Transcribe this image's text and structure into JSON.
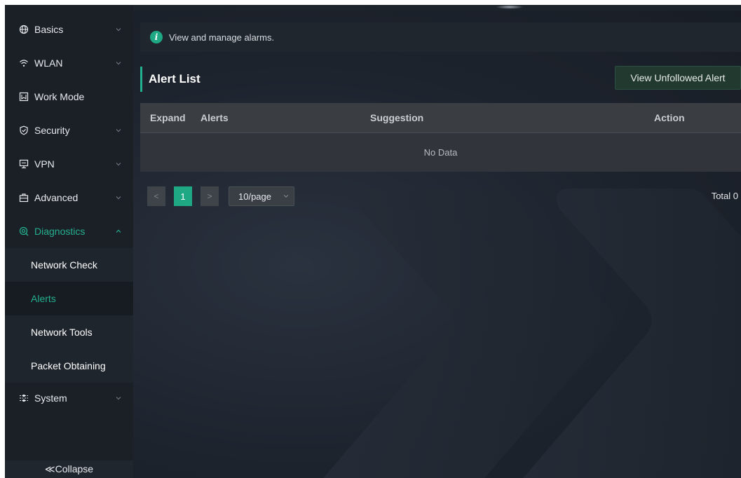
{
  "sidebar": {
    "items": [
      {
        "label": "Basics",
        "icon": "globe-icon",
        "expandable": true
      },
      {
        "label": "WLAN",
        "icon": "wifi-icon",
        "expandable": true
      },
      {
        "label": "Work Mode",
        "icon": "work-mode-icon",
        "expandable": false
      },
      {
        "label": "Security",
        "icon": "shield-icon",
        "expandable": true
      },
      {
        "label": "VPN",
        "icon": "monitor-icon",
        "expandable": true
      },
      {
        "label": "Advanced",
        "icon": "toolbox-icon",
        "expandable": true
      },
      {
        "label": "Diagnostics",
        "icon": "diagnostics-icon",
        "expandable": true,
        "expanded": true
      },
      {
        "label": "System",
        "icon": "sliders-icon",
        "expandable": true
      }
    ],
    "diagnostics_sub": [
      {
        "label": "Network Check"
      },
      {
        "label": "Alerts",
        "selected": true
      },
      {
        "label": "Network Tools"
      },
      {
        "label": "Packet Obtaining"
      }
    ],
    "collapse_label": "≪Collapse"
  },
  "info": {
    "text": "View and manage alarms.",
    "icon": "info-icon"
  },
  "section": {
    "title": "Alert List"
  },
  "toolbar": {
    "unfollowed_label": "View Unfollowed Alert"
  },
  "table": {
    "columns": [
      "Expand",
      "Alerts",
      "Suggestion",
      "Action"
    ],
    "empty_text": "No Data"
  },
  "pagination": {
    "prev": "<",
    "current_page": "1",
    "next": ">",
    "page_size": "10/page",
    "total": "Total 0"
  },
  "colors": {
    "accent": "#1fa884",
    "background": "#1d232d",
    "sidebar": "#1b2027"
  }
}
